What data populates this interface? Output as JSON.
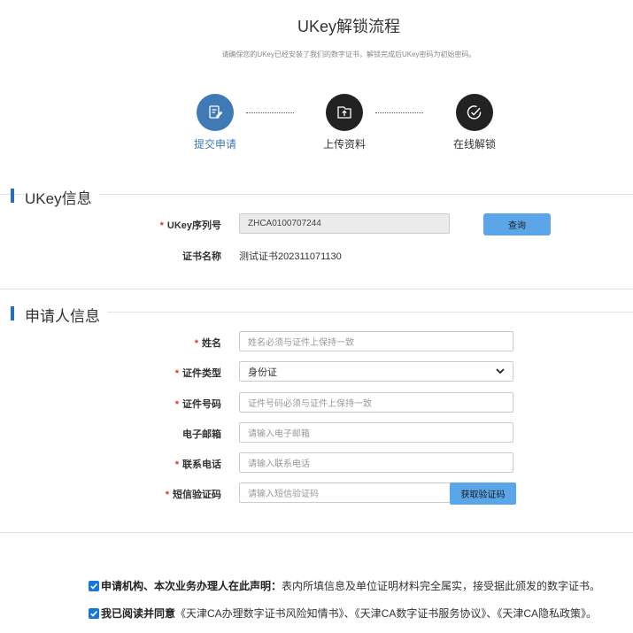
{
  "header": {
    "title": "UKey解锁流程",
    "subtitle": "请确保您的UKey已经安装了我们的数字证书，解锁完成后UKey密码为初始密码。"
  },
  "steps": [
    {
      "label": "提交申请",
      "icon": "edit-doc-icon",
      "active": true
    },
    {
      "label": "上传资料",
      "icon": "upload-icon",
      "active": false
    },
    {
      "label": "在线解锁",
      "icon": "check-circle-icon",
      "active": false
    }
  ],
  "ukey_section": {
    "title": "UKey信息",
    "serial_label": "UKey序列号",
    "serial_value": "ZHCA0100707244",
    "query_button": "查询",
    "cert_label": "证书名称",
    "cert_value": "测试证书202311071130"
  },
  "applicant_section": {
    "title": "申请人信息",
    "name_label": "姓名",
    "name_placeholder": "姓名必须与证件上保持一致",
    "id_type_label": "证件类型",
    "id_type_value": "身份证",
    "id_no_label": "证件号码",
    "id_no_placeholder": "证件号码必须与证件上保持一致",
    "email_label": "电子邮箱",
    "email_placeholder": "请输入电子邮箱",
    "phone_label": "联系电话",
    "phone_placeholder": "请输入联系电话",
    "sms_label": "短信验证码",
    "sms_placeholder": "请输入短信验证码",
    "sms_button": "获取验证码"
  },
  "declarations": {
    "line1_bold": "申请机构、本次业务办理人在此声明：",
    "line1_text": "表内所填信息及单位证明材料完全属实，接受据此颁发的数字证书。",
    "line2_bold": "我已阅读并同意",
    "line2_text": "《天津CA办理数字证书风险知情书》、《天津CA数字证书服务协议》、《天津CA隐私政策》。"
  },
  "colors": {
    "accent": "#3f7ab7",
    "button": "#5aa6e9",
    "required": "#d33333",
    "checkbox": "#1877d8"
  }
}
